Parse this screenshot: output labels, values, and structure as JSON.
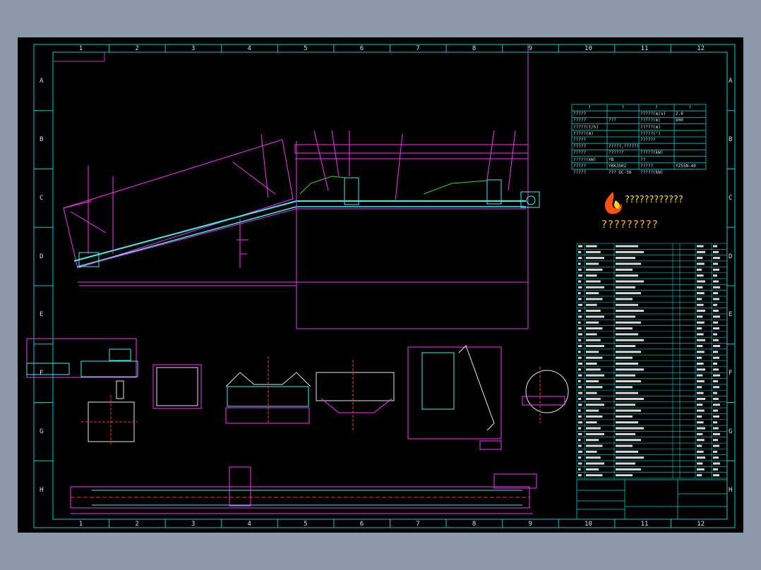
{
  "grid": {
    "columns": [
      "1",
      "2",
      "3",
      "4",
      "5",
      "6",
      "7",
      "8",
      "9",
      "10",
      "11",
      "12"
    ],
    "rows": [
      "A",
      "B",
      "C",
      "D",
      "E",
      "F",
      "G",
      "H"
    ]
  },
  "logo": {
    "line1": "????????????",
    "line2": "?????????"
  },
  "tech_table": {
    "header": [
      "?",
      "?",
      "?",
      "?"
    ],
    "rows": [
      [
        "?????",
        "",
        "?????(m/s)",
        "2.0"
      ],
      [
        "?????",
        "???",
        "?????(m)",
        "800"
      ],
      [
        "?????(t/h)",
        "",
        "?????(m)",
        ""
      ],
      [
        "?????(m)",
        "",
        "?????(°)",
        ""
      ],
      [
        "?????",
        "",
        "??????",
        ""
      ],
      [
        "?????",
        "?????,?????(kW)",
        "",
        ""
      ],
      [
        "?????",
        "??????",
        "?????(kW)",
        ""
      ],
      [
        "?????(kW)",
        "YB",
        "??",
        ""
      ],
      [
        "?????",
        "YKK3502",
        "?????",
        "YZ55N-40"
      ],
      [
        "?????",
        "??? GC-56",
        "?????(kW)",
        ""
      ]
    ]
  },
  "colors": {
    "sheet": "#000000",
    "frame": "#00d8d8",
    "magenta": "#ff30ff",
    "cyan": "#40f0f0",
    "red": "#ff3030",
    "white": "#e8e8e8",
    "green": "#30e030",
    "yellow": "#f0e020"
  }
}
